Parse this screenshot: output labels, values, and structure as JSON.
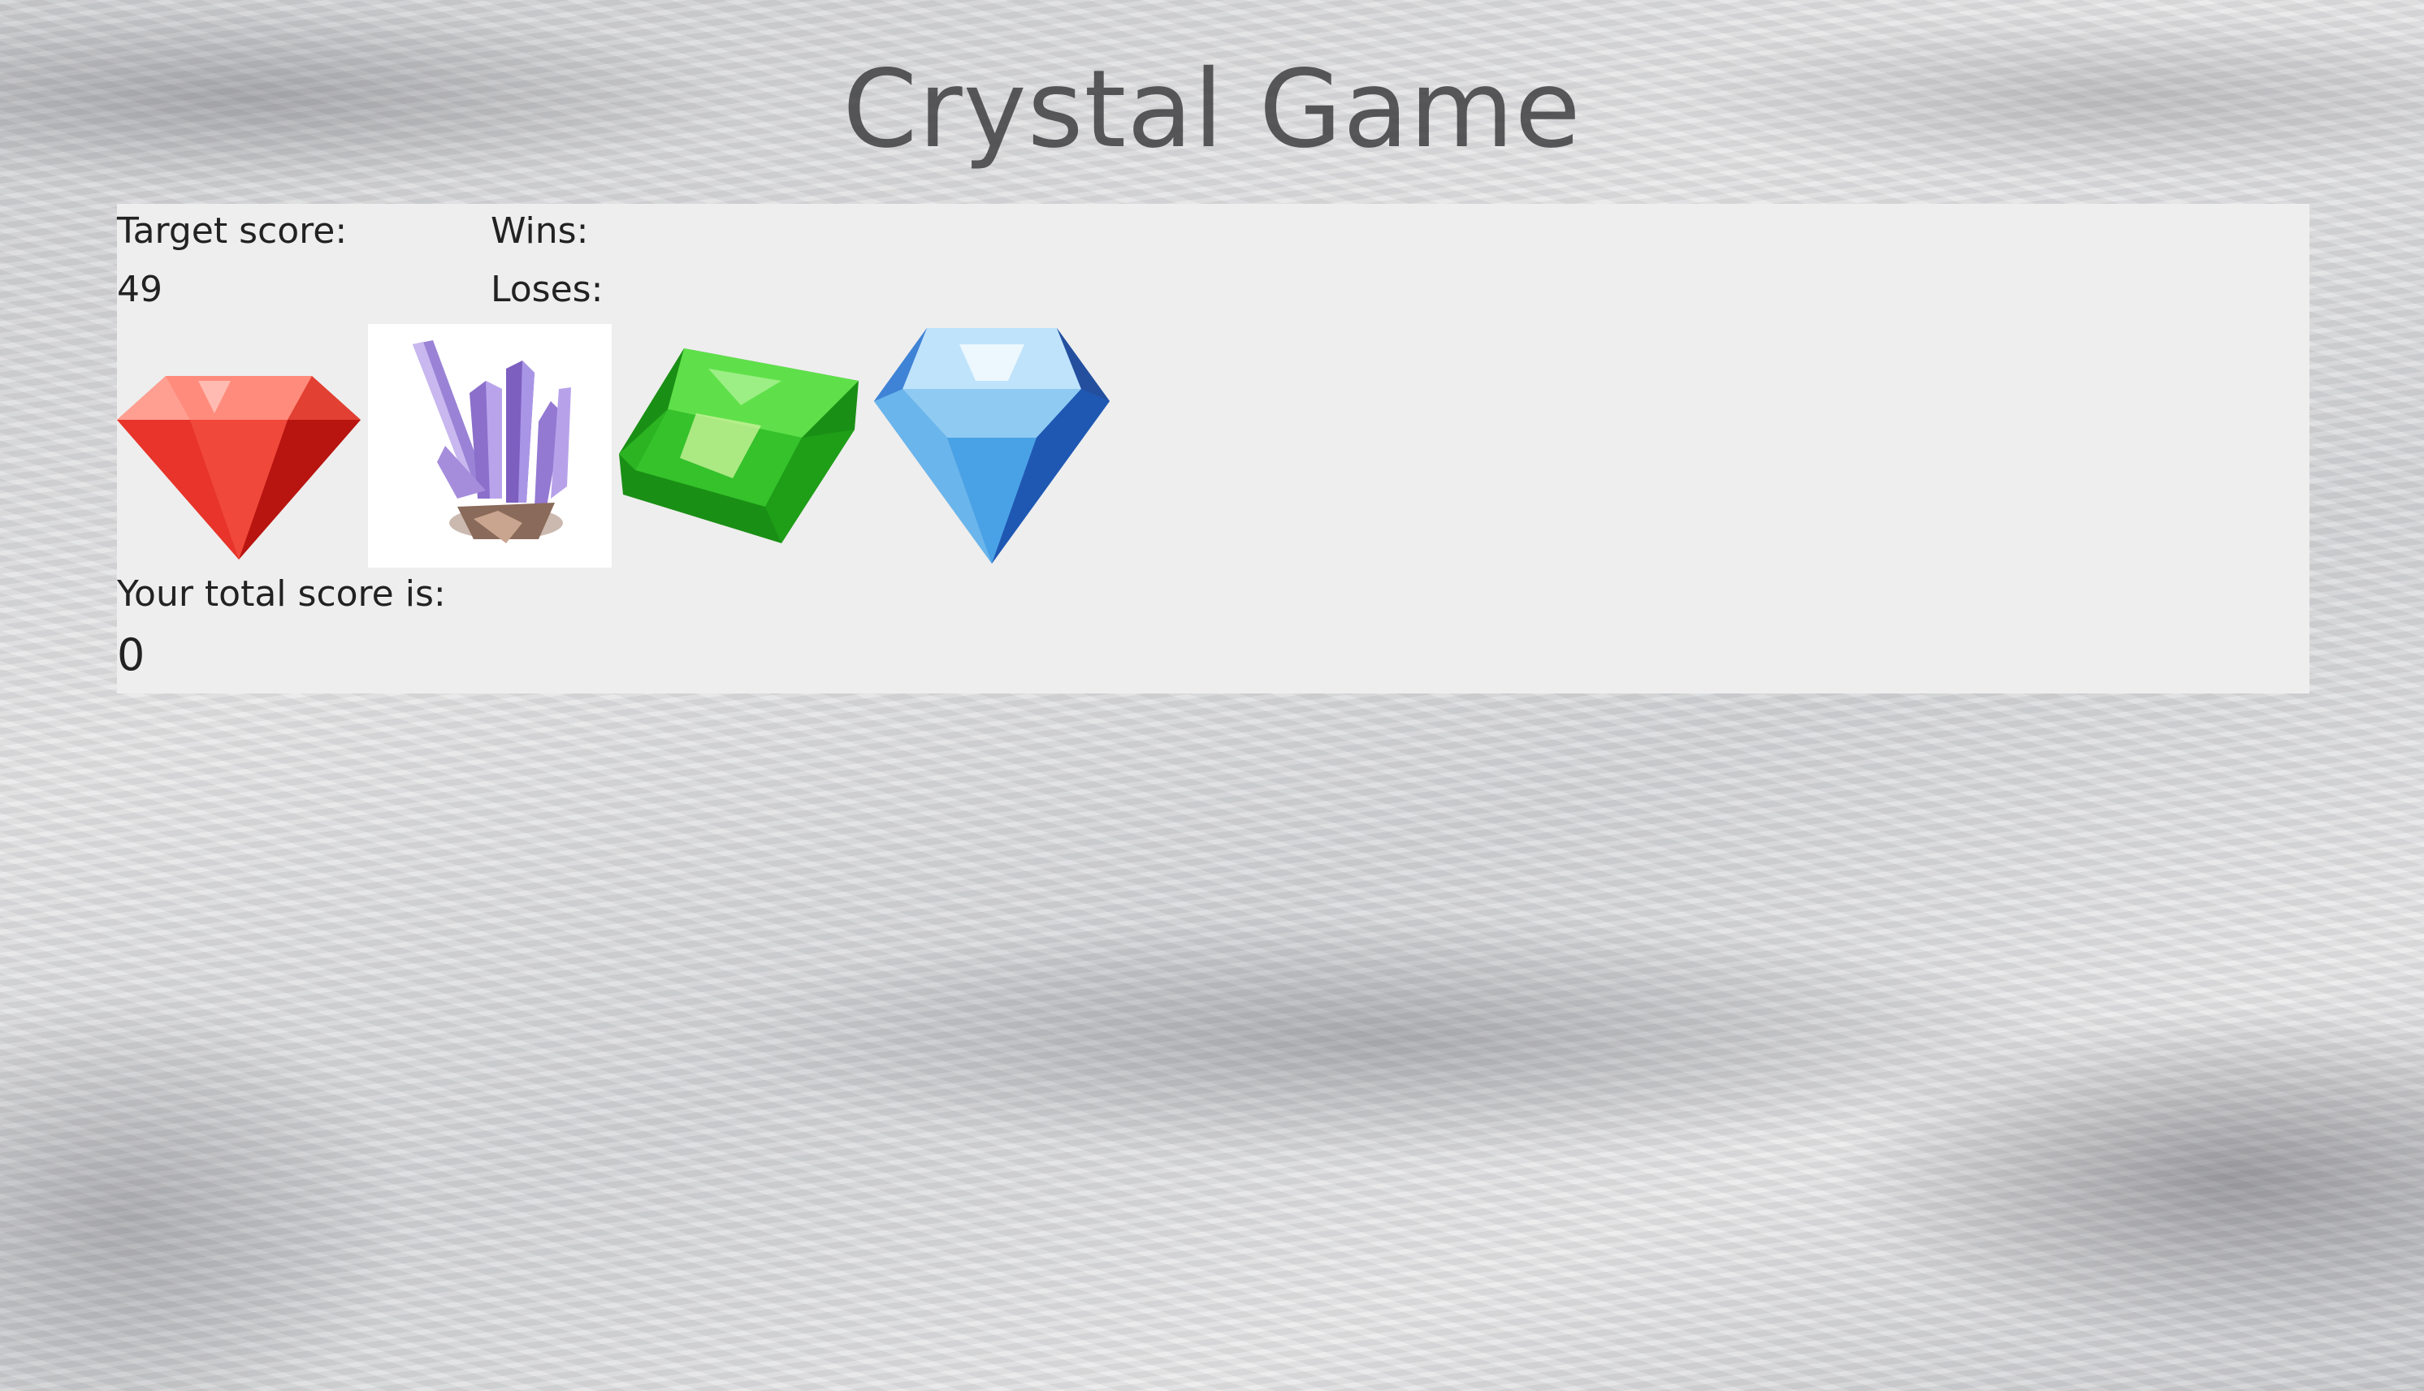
{
  "title": "Crystal Game",
  "scoreboard": {
    "target_label": "Target score:",
    "target_value": "49",
    "wins_label": "Wins:",
    "loses_label": "Loses:"
  },
  "crystals": [
    {
      "icon": "red-gem-icon"
    },
    {
      "icon": "purple-crystal-cluster-icon"
    },
    {
      "icon": "green-gem-icon"
    },
    {
      "icon": "blue-diamond-icon"
    }
  ],
  "total": {
    "label": "Your total score is:",
    "value": "0"
  },
  "colors": {
    "panel": "#eeeeee",
    "text": "#222222",
    "red_gem": "#e8342a",
    "purple_crystal": "#8a6bc0",
    "green_gem": "#35c22b",
    "blue_diamond": "#4aa2e6"
  }
}
